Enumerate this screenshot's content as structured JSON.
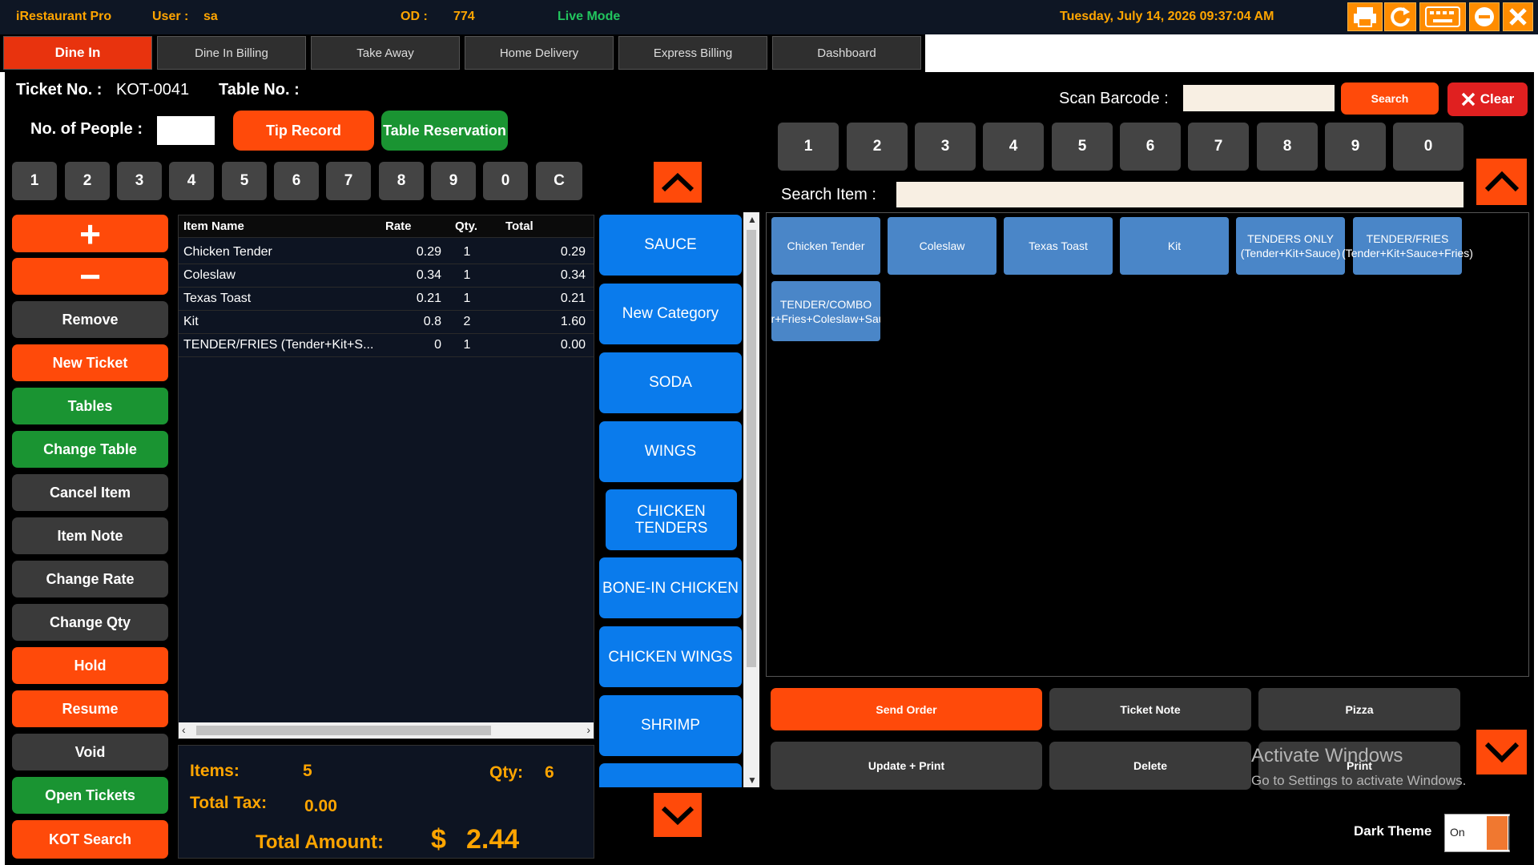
{
  "topbar": {
    "app_name": "iRestaurant Pro",
    "user_label": "User :",
    "user_value": "sa",
    "od_label": "OD :",
    "od_value": "774",
    "mode": "Live Mode",
    "datetime": "Tuesday, July 14, 2026 09:37:04 AM",
    "icons": [
      "printer-icon",
      "refresh-icon",
      "keyboard-icon",
      "minimize-icon",
      "close-icon"
    ]
  },
  "tabs": [
    {
      "label": "Dine In",
      "active": true
    },
    {
      "label": "Dine In Billing"
    },
    {
      "label": "Take Away"
    },
    {
      "label": "Home Delivery"
    },
    {
      "label": "Express Billing"
    },
    {
      "label": "Dashboard"
    }
  ],
  "ticket": {
    "ticket_no_label": "Ticket No. :",
    "ticket_no": "KOT-0041",
    "table_no_label": "Table No. :",
    "people_label": "No. of People :",
    "people_value": "",
    "tip_record": "Tip Record",
    "table_reservation": "Table Reservation"
  },
  "keypad_left": [
    "1",
    "2",
    "3",
    "4",
    "5",
    "6",
    "7",
    "8",
    "9",
    "0",
    "C"
  ],
  "side_buttons": {
    "plus": "+",
    "minus": "−",
    "remove": "Remove",
    "new_ticket": "New Ticket",
    "tables": "Tables",
    "change_table": "Change Table",
    "cancel_item": "Cancel Item",
    "item_note": "Item Note",
    "change_rate": "Change Rate",
    "change_qty": "Change Qty",
    "hold": "Hold",
    "resume": "Resume",
    "void": "Void",
    "open_tickets": "Open Tickets",
    "kot_search": "KOT Search"
  },
  "order_grid": {
    "headers": {
      "name": "Item Name",
      "rate": "Rate",
      "qty": "Qty.",
      "total": "Total"
    },
    "rows": [
      {
        "name": "Chicken Tender",
        "rate": "0.29",
        "qty": "1",
        "total": "0.29"
      },
      {
        "name": "Coleslaw",
        "rate": "0.34",
        "qty": "1",
        "total": "0.34"
      },
      {
        "name": "Texas Toast",
        "rate": "0.21",
        "qty": "1",
        "total": "0.21"
      },
      {
        "name": "Kit",
        "rate": "0.8",
        "qty": "2",
        "total": "1.60"
      },
      {
        "name": "TENDER/FRIES (Tender+Kit+S...",
        "rate": "0",
        "qty": "1",
        "total": "0.00"
      }
    ]
  },
  "totals": {
    "items_label": "Items:",
    "items_value": "5",
    "qty_label": "Qty:",
    "qty_value": "6",
    "tax_label": "Total Tax:",
    "tax_value": "0.00",
    "amount_label": "Total Amount:",
    "currency": "$",
    "amount_value": "2.44"
  },
  "categories": [
    "SAUCE",
    "New Category",
    "SODA",
    "WINGS",
    "CHICKEN TENDERS",
    "BONE-IN CHICKEN",
    "CHICKEN WINGS",
    "SHRIMP"
  ],
  "search": {
    "barcode_label": "Scan Barcode :",
    "barcode_value": "",
    "search_btn": "Search",
    "clear_btn": "Clear",
    "item_label": "Search Item :",
    "item_value": ""
  },
  "keypad_right": [
    "1",
    "2",
    "3",
    "4",
    "5",
    "6",
    "7",
    "8",
    "9",
    "0"
  ],
  "items": [
    "Chicken Tender",
    "Coleslaw",
    "Texas Toast",
    "Kit",
    "TENDERS ONLY (Tender+Kit+Sauce)",
    "TENDER/FRIES (Tender+Kit+Sauce+Fries)",
    "TENDER/COMBO (Tender+Fries+Coleslaw+Sauce+To"
  ],
  "actions": {
    "send_order": "Send Order",
    "ticket_note": "Ticket Note",
    "pizza": "Pizza",
    "update_print": "Update + Print",
    "delete": "Delete",
    "print": "Print"
  },
  "watermark": {
    "title": "Activate Windows",
    "subtitle": "Go to Settings to activate Windows."
  },
  "theme": {
    "label": "Dark Theme",
    "toggle": "On"
  }
}
